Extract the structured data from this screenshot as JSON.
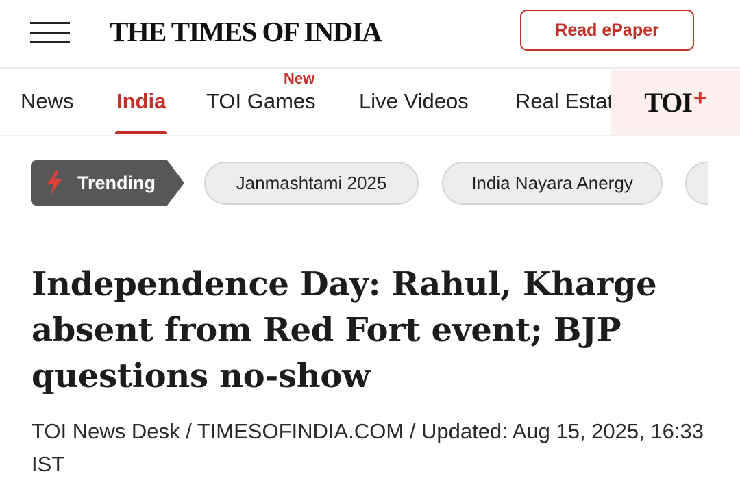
{
  "header": {
    "logo_text": "THE TIMES OF INDIA",
    "epaper_label": "Read ePaper"
  },
  "nav": {
    "items": [
      {
        "label": "News",
        "active": false
      },
      {
        "label": "India",
        "active": true
      },
      {
        "label": "TOI Games",
        "active": false,
        "badge": "New"
      },
      {
        "label": "Live Videos",
        "active": false
      },
      {
        "label": "Real Estate",
        "active": false
      }
    ],
    "toi_plus": {
      "text": "TOI",
      "plus": "+"
    }
  },
  "trending": {
    "label": "Trending",
    "chips": [
      "Janmashtami 2025",
      "India Nayara Anergy"
    ]
  },
  "article": {
    "headline": "Independence Day: Rahul, Kharge absent from Red Fort event; BJP questions no-show",
    "byline": "TOI News Desk / TIMESOFINDIA.COM / Updated: Aug 15, 2025, 16:33 IST"
  },
  "colors": {
    "accent": "#c3302a",
    "trending_bg": "#575757",
    "chip_bg": "#ededed",
    "toi_plus_bg": "#fdf0ef"
  },
  "icons": {
    "menu": "hamburger-menu-icon",
    "trending": "lightning-bolt-icon"
  }
}
